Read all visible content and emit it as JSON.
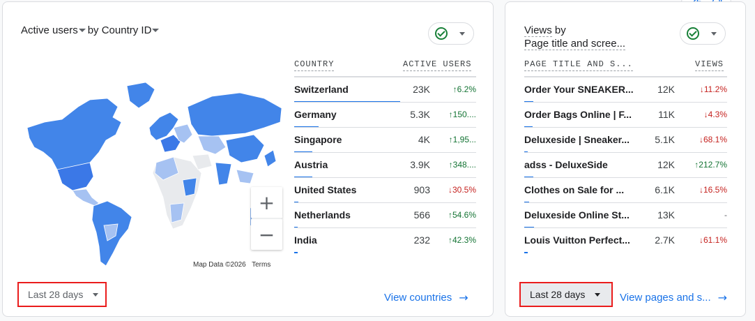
{
  "left_card": {
    "metric": "Active users",
    "by": "by Country ID",
    "col_country": "COUNTRY",
    "col_active": "ACTIVE USERS",
    "rows": [
      {
        "name": "Switzerland",
        "value": "23K",
        "change": "6.2%",
        "dir": "up",
        "bar": 1.0
      },
      {
        "name": "Germany",
        "value": "5.3K",
        "change": "150....",
        "dir": "up",
        "bar": 0.23
      },
      {
        "name": "Singapore",
        "value": "4K",
        "change": "1,95...",
        "dir": "up",
        "bar": 0.17
      },
      {
        "name": "Austria",
        "value": "3.9K",
        "change": "348....",
        "dir": "up",
        "bar": 0.17
      },
      {
        "name": "United States",
        "value": "903",
        "change": "30.5%",
        "dir": "down",
        "bar": 0.04
      },
      {
        "name": "Netherlands",
        "value": "566",
        "change": "54.6%",
        "dir": "up",
        "bar": 0.025
      },
      {
        "name": "India",
        "value": "232",
        "change": "42.3%",
        "dir": "up",
        "bar": 0.01
      }
    ],
    "map_credit": "Map Data ©2026",
    "map_terms": "Terms",
    "zoom_in": "+",
    "zoom_out": "−",
    "date_range": "Last 28 days",
    "link": "View countries"
  },
  "right_card": {
    "title_line1": "Views",
    "title_line1_rest": " by",
    "title_line2": "Page title and scree...",
    "col_page": "PAGE TITLE AND S...",
    "col_views": "VIEWS",
    "rows": [
      {
        "name": "Order Your SNEAKER...",
        "value": "12K",
        "change": "11.2%",
        "dir": "down",
        "bar": 0.92
      },
      {
        "name": "Order Bags Online | F...",
        "value": "11K",
        "change": "4.3%",
        "dir": "down",
        "bar": 0.85
      },
      {
        "name": "Deluxeside | Sneaker...",
        "value": "5.1K",
        "change": "68.1%",
        "dir": "down",
        "bar": 0.39
      },
      {
        "name": "adss - DeluxeSide",
        "value": "12K",
        "change": "212.7%",
        "dir": "up",
        "bar": 0.92
      },
      {
        "name": "Clothes on Sale for ...",
        "value": "6.1K",
        "change": "16.5%",
        "dir": "down",
        "bar": 0.47
      },
      {
        "name": "Deluxeside Online St...",
        "value": "13K",
        "change": "-",
        "dir": "flat",
        "bar": 1.0
      },
      {
        "name": "Louis Vuitton Perfect...",
        "value": "2.7K",
        "change": "61.1%",
        "dir": "down",
        "bar": 0.21
      }
    ],
    "date_range": "Last 28 days",
    "link": "View pages and s..."
  },
  "icons": {
    "up_arrow": "↑",
    "down_arrow": "↓",
    "right_arrow": "→",
    "thumb_up": "👍",
    "thumb_down": "👎"
  },
  "colors": {
    "accent": "#1a73e8",
    "up": "#137333",
    "down": "#c5221f",
    "highlight_box": "#ea1c1c"
  }
}
